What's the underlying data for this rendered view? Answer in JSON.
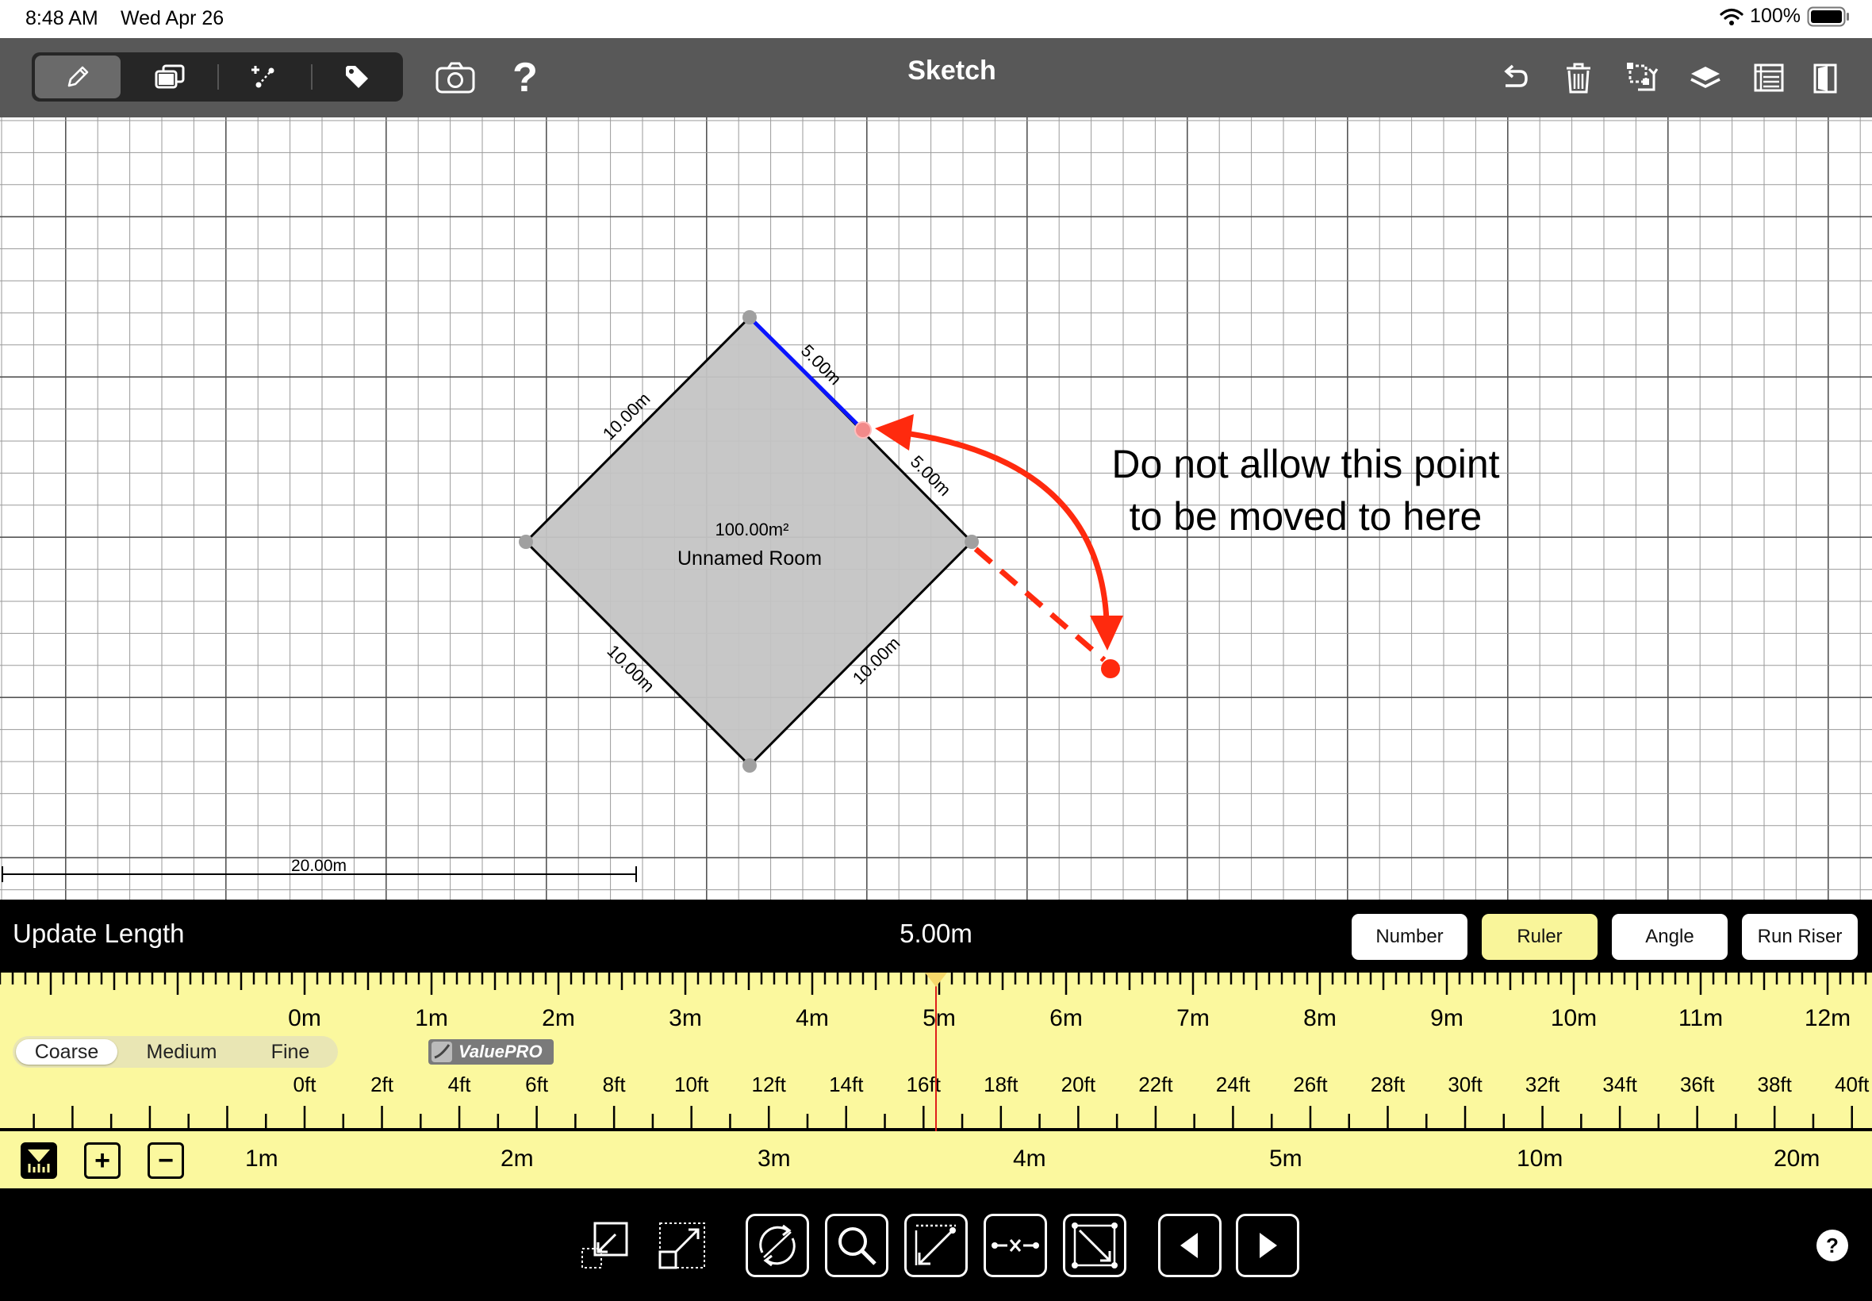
{
  "status": {
    "time": "8:48 AM",
    "date": "Wed Apr 26",
    "battery": "100%"
  },
  "toolbar": {
    "title": "Sketch",
    "left_tools": [
      "pencil-icon",
      "layers-copy-icon",
      "add-point-icon",
      "tag-icon"
    ],
    "extra_tools": [
      "camera-icon",
      "help-icon"
    ],
    "right_tools": [
      "undo-icon",
      "trash-icon",
      "transform-icon",
      "stack-icon",
      "report-icon",
      "door-icon"
    ]
  },
  "canvas": {
    "room_area": "100.00m²",
    "room_name": "Unnamed Room",
    "edge_labels": [
      "10.00m",
      "5.00m",
      "5.00m",
      "10.00m",
      "10.00m"
    ],
    "scale_label": "20.00m",
    "annotation_line1": "Do not allow this point",
    "annotation_line2": "to be moved to here",
    "colors": {
      "selected_edge": "#0a14ff",
      "annotation": "#ff2a0e",
      "room_fill": "#c4c4c4"
    }
  },
  "panel": {
    "title": "Update Length",
    "value": "5.00m",
    "modes": [
      "Number",
      "Ruler",
      "Angle",
      "Run Riser"
    ],
    "active_mode": "Ruler"
  },
  "ruler": {
    "metric_labels": [
      "0m",
      "1m",
      "2m",
      "3m",
      "4m",
      "5m",
      "6m",
      "7m",
      "8m",
      "9m",
      "10m",
      "11m",
      "12m"
    ],
    "imperial_labels": [
      "0ft",
      "2ft",
      "4ft",
      "6ft",
      "8ft",
      "10ft",
      "12ft",
      "14ft",
      "16ft",
      "18ft",
      "20ft",
      "22ft",
      "24ft",
      "26ft",
      "28ft",
      "30ft",
      "32ft",
      "34ft",
      "36ft",
      "38ft",
      "40ft"
    ],
    "detail_options": [
      "Coarse",
      "Medium",
      "Fine"
    ],
    "selected_detail": "Coarse",
    "brand": "ValuePRO",
    "current_value_m": 5.0
  },
  "zoom": {
    "labels": [
      "1m",
      "2m",
      "3m",
      "4m",
      "5m",
      "10m",
      "20m"
    ]
  },
  "bottombar": {
    "tools": [
      "shrink-icon",
      "expand-icon",
      "rotate-icon",
      "zoom-icon",
      "measure-line-icon",
      "split-edge-icon",
      "diagonal-icon",
      "previous-icon",
      "next-icon"
    ],
    "help": "?"
  }
}
